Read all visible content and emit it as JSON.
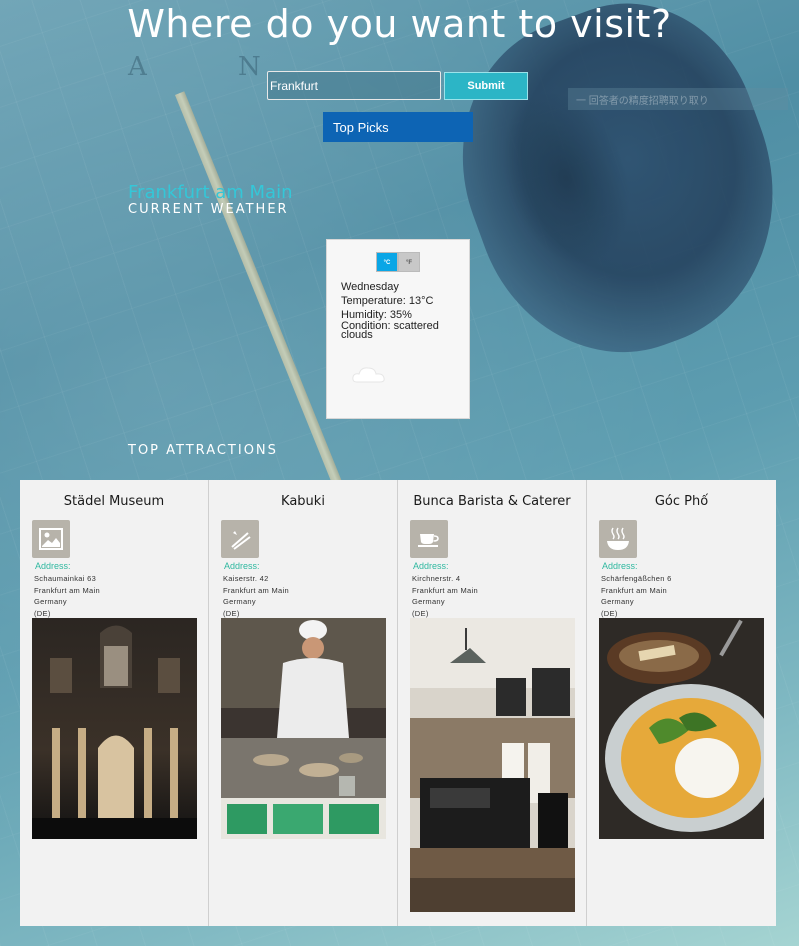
{
  "header": {
    "title": "Where do you want to visit?",
    "search_value": "Frankfurt",
    "submit_label": "Submit",
    "top_picks_label": "Top Picks"
  },
  "background_text": {
    "letter_a": "A",
    "letter_n": "N",
    "ghost": "一 回答者の精度招聘取り取り"
  },
  "weather": {
    "city": "Frankfurt am Main",
    "section_label": "CURRENT WEATHER",
    "unit_celsius": "°C",
    "unit_fahrenheit": "°F",
    "day": "Wednesday",
    "temperature": "Temperature: 13°C",
    "humidity": "Humidity: 35%",
    "condition": "Condition: scattered clouds",
    "icon": "cloud-icon"
  },
  "attractions": {
    "section_label": "TOP ATTRACTIONS",
    "address_label": "Address:",
    "items": [
      {
        "name": "Städel Museum",
        "icon": "image-icon",
        "street": "Schaumainkai 63",
        "city": "Frankfurt am Main",
        "country": "Germany",
        "code": "(DE)"
      },
      {
        "name": "Kabuki",
        "icon": "chopsticks-icon",
        "street": "Kaiserstr. 42",
        "city": "Frankfurt am Main",
        "country": "Germany",
        "code": "(DE)"
      },
      {
        "name": "Bunca Barista & Caterer",
        "icon": "coffee-cup-icon",
        "street": "Kirchnerstr. 4",
        "city": "Frankfurt am Main",
        "country": "Germany",
        "code": "(DE)"
      },
      {
        "name": "Góc Phố",
        "icon": "hot-bowl-icon",
        "street": "Schärfengäßchen 6",
        "city": "Frankfurt am Main",
        "country": "Germany",
        "code": "(DE)"
      }
    ]
  },
  "colors": {
    "accent": "#2cb5c6",
    "city_name": "#34c7d8",
    "top_picks": "#0d64b4",
    "address_label": "#2fb8a0",
    "celsius_active": "#0aa6e6"
  }
}
